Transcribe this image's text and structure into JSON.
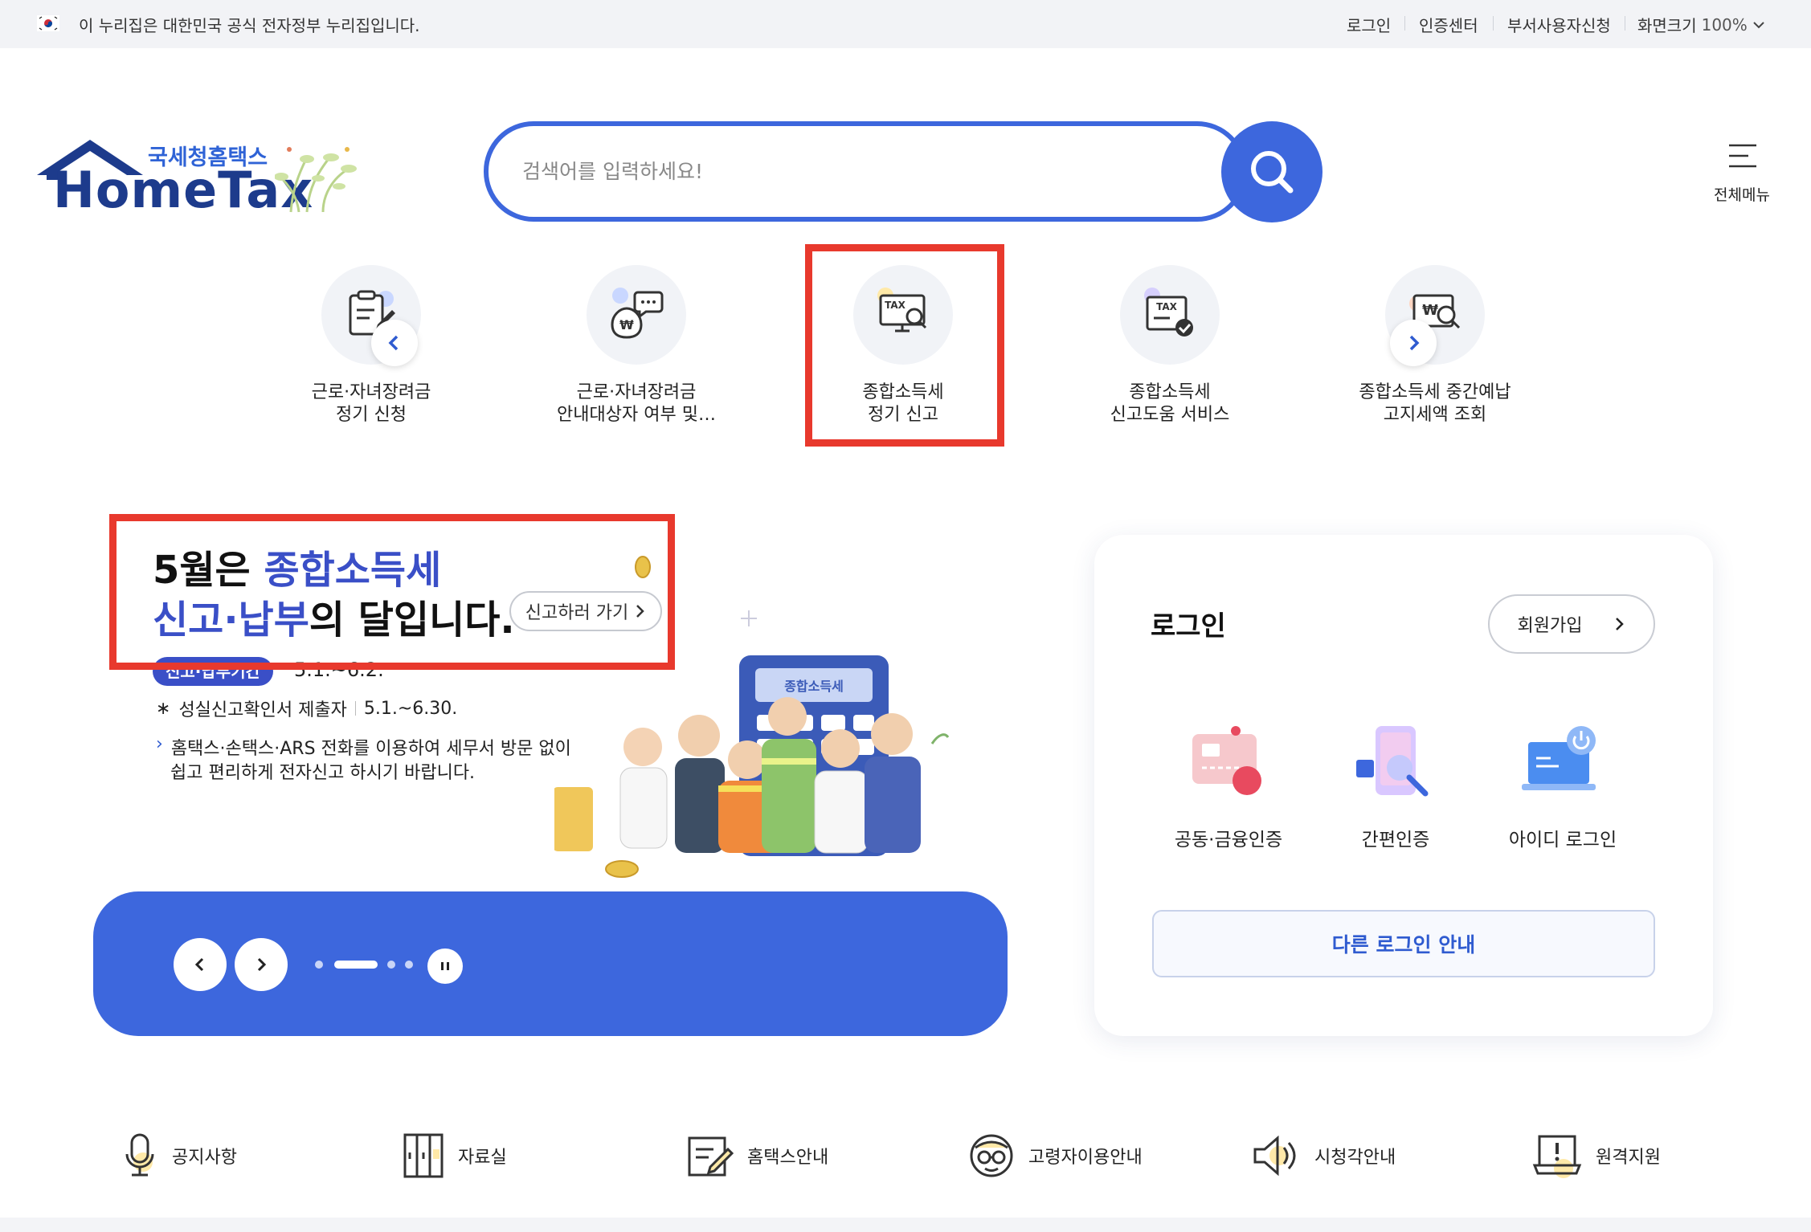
{
  "gov_bar": {
    "notice": "이 누리집은 대한민국 공식 전자정부 누리집입니다.",
    "links": [
      "로그인",
      "인증센터",
      "부서사용자신청"
    ],
    "zoom_label": "화면크기",
    "zoom_value": "100%"
  },
  "logo": {
    "korean": "국세청홈택스",
    "english": "HomeTax"
  },
  "search": {
    "placeholder": "검색어를 입력하세요!"
  },
  "all_menu_label": "전체메뉴",
  "quick_services": [
    {
      "line1": "근로·자녀장려금",
      "line2": "정기 신청",
      "icon": "clipboard-edit-icon"
    },
    {
      "line1": "근로·자녀장려금",
      "line2": "안내대상자 여부 및…",
      "icon": "money-chat-icon"
    },
    {
      "line1": "종합소득세",
      "line2": "정기 신고",
      "icon": "tax-monitor-search-icon"
    },
    {
      "line1": "종합소득세",
      "line2": "신고도움 서비스",
      "icon": "tax-document-check-icon"
    },
    {
      "line1": "종합소득세 중간예납",
      "line2": "고지세액 조회",
      "icon": "won-document-search-icon"
    }
  ],
  "banner": {
    "title_line1_a": "5월은 ",
    "title_line1_b": "종합소득세",
    "title_line2_a": "신고·납부",
    "title_line2_b": "의 달입니다.",
    "cta": "신고하러 가기",
    "period_badge": "신고·납부기간",
    "period": "5.1.~6.2.",
    "line1_label": "성실신고확인서 제출자",
    "line1_period": "5.1.~6.30.",
    "line2": "홈택스·손택스·ARS 전화를 이용하여 세무서 방문 없이",
    "line3": "쉽고 편리하게 전자신고 하시기 바랍니다.",
    "calculator_label": "종합소득세"
  },
  "carousel": {
    "total_slides": 4,
    "active_slide": 2
  },
  "login": {
    "title": "로그인",
    "join": "회원가입",
    "methods": [
      {
        "label": "공동·금융인증",
        "icon": "certificate-card-icon"
      },
      {
        "label": "간편인증",
        "icon": "phone-search-icon"
      },
      {
        "label": "아이디 로그인",
        "icon": "laptop-power-icon"
      }
    ],
    "other": "다른 로그인 안내"
  },
  "bottom_links": [
    {
      "label": "공지사항",
      "icon": "microphone-icon"
    },
    {
      "label": "자료실",
      "icon": "archive-icon"
    },
    {
      "label": "홈택스안내",
      "icon": "document-pen-icon"
    },
    {
      "label": "고령자이용안내",
      "icon": "elderly-glasses-icon"
    },
    {
      "label": "시청각안내",
      "icon": "speaker-icon"
    },
    {
      "label": "원격지원",
      "icon": "remote-laptop-icon"
    }
  ],
  "colors": {
    "primary": "#3d67dd",
    "navy": "#1d3b8c",
    "highlight_box": "#e8392d"
  }
}
